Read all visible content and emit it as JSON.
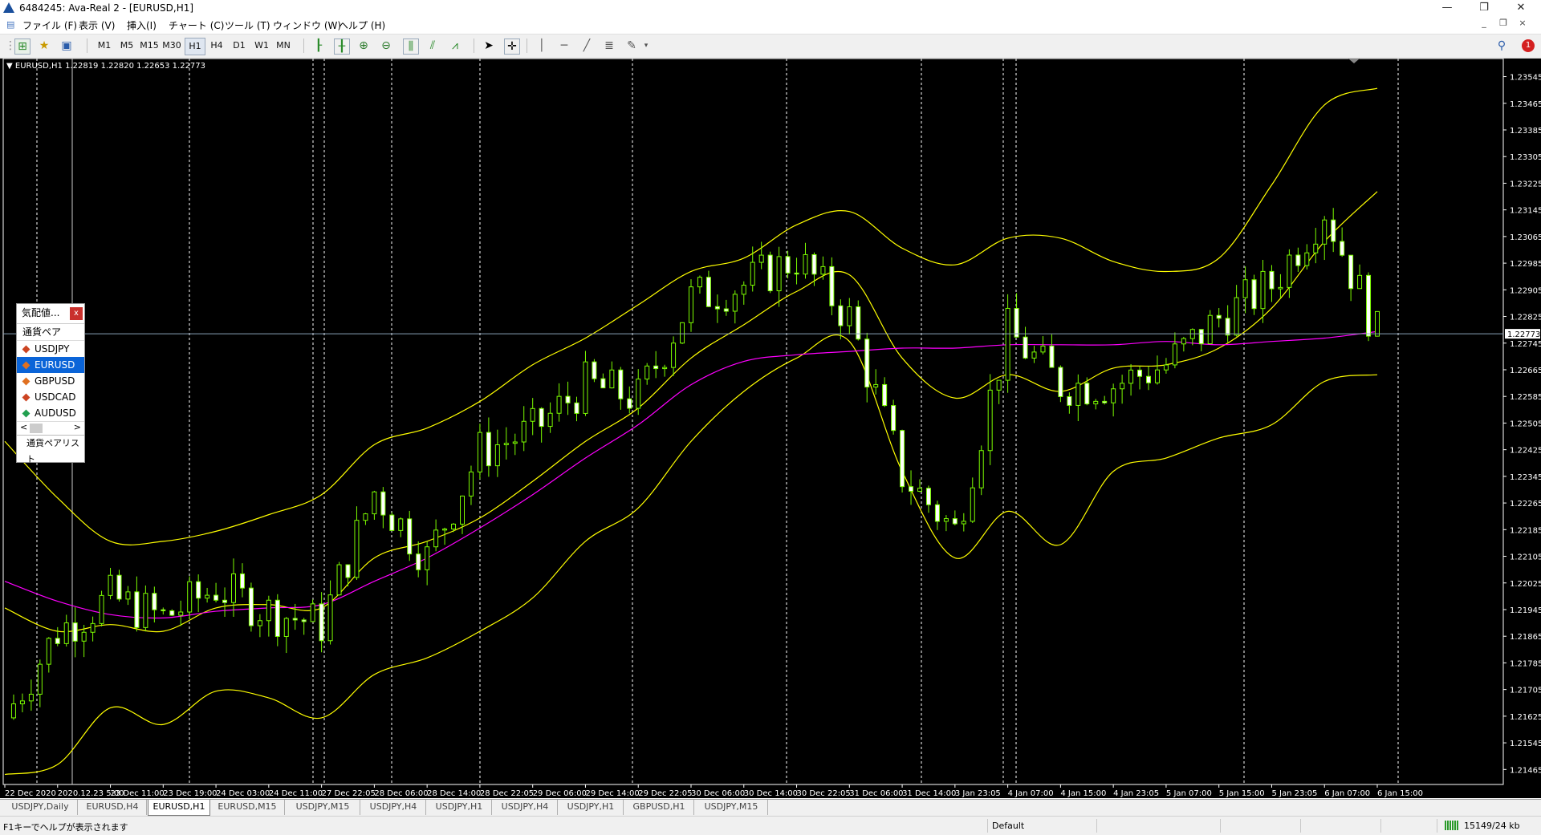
{
  "window": {
    "title": "6484245: Ava-Real 2 - [EURUSD,H1]",
    "min_glyph": "—",
    "restore_glyph": "❐",
    "close_glyph": "✕",
    "mdi_min_glyph": "_",
    "mdi_restore_glyph": "❐",
    "mdi_close_glyph": "×"
  },
  "menu": [
    "ファイル (F)",
    "表示 (V)",
    "挿入(I)",
    "チャート (C)",
    "ツール (T)",
    "ウィンドウ (W)",
    "ヘルプ (H)"
  ],
  "toolbar": {
    "timeframes": [
      "M1",
      "M5",
      "M15",
      "M30",
      "H1",
      "H4",
      "D1",
      "W1",
      "MN"
    ],
    "active_timeframe": "H1",
    "notification_count": "1"
  },
  "chart": {
    "info": "EURUSD,H1  1.22819 1.22820 1.22653 1.22773",
    "current_price": "1.22773",
    "price_labels": [
      "1.23545",
      "1.23465",
      "1.23385",
      "1.23305",
      "1.23225",
      "1.23145",
      "1.23065",
      "1.22985",
      "1.22905",
      "1.22825",
      "1.22745",
      "1.22665",
      "1.22585",
      "1.22505",
      "1.22425",
      "1.22345",
      "1.22265",
      "1.22185",
      "1.22105",
      "1.22025",
      "1.21945",
      "1.21865",
      "1.21785",
      "1.21705",
      "1.21625",
      "1.21545",
      "1.21465"
    ],
    "time_labels": [
      "22 Dec 2020",
      "2020.12.23 5:00",
      "23 Dec 11:00",
      "23 Dec 19:00",
      "24 Dec 03:00",
      "24 Dec 11:00",
      "27 Dec 22:05",
      "28 Dec 06:00",
      "28 Dec 14:00",
      "28 Dec 22:05",
      "29 Dec 06:00",
      "29 Dec 14:00",
      "29 Dec 22:05",
      "30 Dec 06:00",
      "30 Dec 14:00",
      "30 Dec 22:05",
      "31 Dec 06:00",
      "31 Dec 14:00",
      "3 Jan 23:05",
      "4 Jan 07:00",
      "4 Jan 15:00",
      "4 Jan 23:05",
      "5 Jan 07:00",
      "5 Jan 15:00",
      "5 Jan 23:05",
      "6 Jan 07:00",
      "6 Jan 15:00"
    ],
    "colors": {
      "background": "#000000",
      "candles": "#7CFC00",
      "bands": "#FFFF00",
      "ma": "#FF00FF",
      "grid": "#FFFFFF"
    }
  },
  "chart_data": {
    "type": "candlestick",
    "symbol": "EURUSD",
    "timeframe": "H1",
    "ylim": [
      1.2142,
      1.2358
    ],
    "x": [
      "22 Dec 2020",
      "2020.12.23 5:00",
      "23 Dec 11:00",
      "23 Dec 19:00",
      "24 Dec 03:00",
      "24 Dec 11:00",
      "27 Dec 22:05",
      "28 Dec 06:00",
      "28 Dec 14:00",
      "28 Dec 22:05",
      "29 Dec 06:00",
      "29 Dec 14:00",
      "29 Dec 22:05",
      "30 Dec 06:00",
      "30 Dec 14:00",
      "30 Dec 22:05",
      "31 Dec 06:00",
      "31 Dec 14:00",
      "3 Jan 23:05",
      "4 Jan 07:00",
      "4 Jan 15:00",
      "4 Jan 23:05",
      "5 Jan 07:00",
      "5 Jan 15:00",
      "5 Jan 23:05",
      "6 Jan 07:00",
      "6 Jan 15:00"
    ],
    "close": [
      1.2162,
      1.2188,
      1.2198,
      1.2192,
      1.2201,
      1.2194,
      1.219,
      1.223,
      1.221,
      1.2242,
      1.2248,
      1.2262,
      1.2258,
      1.2288,
      1.2292,
      1.23,
      1.2282,
      1.2235,
      1.2218,
      1.2278,
      1.2262,
      1.2262,
      1.2268,
      1.2282,
      1.2292,
      1.2315,
      1.2277
    ],
    "series": [
      {
        "name": "",
        "values": [
          1.2245,
          1.2228,
          1.2215,
          1.2215,
          1.2218,
          1.2223,
          1.2229,
          1.2244,
          1.2249,
          1.2257,
          1.2268,
          1.2276,
          1.2286,
          1.2296,
          1.23,
          1.231,
          1.2314,
          1.2303,
          1.2298,
          1.2306,
          1.2306,
          1.2299,
          1.2296,
          1.23,
          1.2322,
          1.2346,
          1.2351
        ]
      },
      {
        "name": "",
        "values": [
          1.2195,
          1.2188,
          1.219,
          1.2188,
          1.2195,
          1.2196,
          1.2195,
          1.221,
          1.2215,
          1.2222,
          1.2233,
          1.2245,
          1.2255,
          1.227,
          1.228,
          1.229,
          1.2295,
          1.227,
          1.2258,
          1.2265,
          1.226,
          1.2267,
          1.2268,
          1.2273,
          1.2285,
          1.2305,
          1.232
        ]
      },
      {
        "name": "",
        "values": [
          1.2145,
          1.2148,
          1.2165,
          1.216,
          1.217,
          1.2168,
          1.2162,
          1.2175,
          1.218,
          1.2188,
          1.2198,
          1.2215,
          1.2225,
          1.2245,
          1.226,
          1.227,
          1.2275,
          1.2236,
          1.221,
          1.2224,
          1.2214,
          1.2236,
          1.224,
          1.2246,
          1.225,
          1.2263,
          1.2265
        ]
      },
      {
        "name": "",
        "values": [
          1.2203,
          1.2197,
          1.2193,
          1.2192,
          1.2194,
          1.2195,
          1.2196,
          1.2203,
          1.221,
          1.2219,
          1.2229,
          1.224,
          1.225,
          1.2262,
          1.2269,
          1.2271,
          1.2272,
          1.2273,
          1.2273,
          1.2274,
          1.2274,
          1.2274,
          1.2275,
          1.2274,
          1.2275,
          1.2276,
          1.2278
        ]
      }
    ]
  },
  "market_watch": {
    "title": "気配値...",
    "close_label": "x",
    "column_header": "通貨ペア",
    "rows": [
      {
        "symbol": "USDJPY",
        "color": "#cc4422"
      },
      {
        "symbol": "EURUSD",
        "color": "#e07020",
        "selected": true
      },
      {
        "symbol": "GBPUSD",
        "color": "#e07020"
      },
      {
        "symbol": "USDCAD",
        "color": "#cc4422"
      },
      {
        "symbol": "AUDUSD",
        "color": "#22a050"
      }
    ],
    "scroll_left": "<",
    "scroll_right": ">",
    "tab_label": "通貨ペアリスト"
  },
  "tabs": [
    {
      "label": "USDJPY,Daily",
      "active": false
    },
    {
      "label": "EURUSD,H4",
      "active": false
    },
    {
      "label": "EURUSD,H1",
      "active": true
    },
    {
      "label": "EURUSD,M15",
      "active": false
    },
    {
      "label": "USDJPY,M15",
      "active": false
    },
    {
      "label": "USDJPY,H4",
      "active": false
    },
    {
      "label": "USDJPY,H1",
      "active": false
    },
    {
      "label": "USDJPY,H4",
      "active": false
    },
    {
      "label": "USDJPY,H1",
      "active": false
    },
    {
      "label": "GBPUSD,H1",
      "active": false
    },
    {
      "label": "USDJPY,M15",
      "active": false
    }
  ],
  "status": {
    "help": "F1キーでヘルプが表示されます",
    "profile": "Default",
    "traffic": "15149/24 kb"
  }
}
